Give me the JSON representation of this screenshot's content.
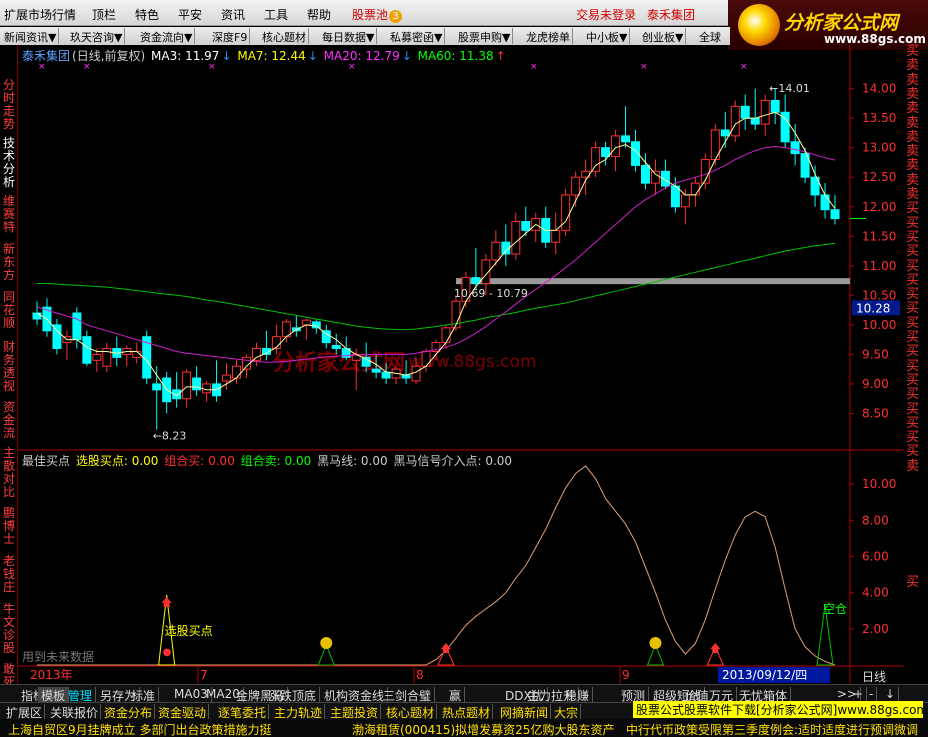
{
  "menubar": {
    "items": [
      "扩展市场行情",
      "顶栏",
      "特色",
      "平安",
      "资讯",
      "工具",
      "帮助"
    ],
    "stock_pool": "股票池",
    "stock_pool_badge": "3",
    "login": "交易未登录",
    "group": "泰禾集团"
  },
  "logo": {
    "title": "分析家公式网",
    "url": "www.88gs.com"
  },
  "toolbar": [
    "新闻资讯▼",
    "玖天咨询▼",
    "资金流向▼",
    "深度F9",
    "核心题材",
    "每日数据▼",
    "私募密函▼",
    "股票申购▼",
    "龙虎榜单",
    "中小板▼",
    "创业板▼",
    "全球"
  ],
  "sidebar": [
    "分时走势",
    "技术分析",
    "维赛特",
    "新东方",
    "同花顺",
    "财务透视",
    "资金流",
    "主散对比",
    "鹏博士",
    "老钱庄",
    "牛文诊股",
    "敢死队"
  ],
  "sell_column": [
    "买",
    "卖",
    "卖",
    "卖",
    "卖",
    "卖",
    "卖",
    "卖",
    "卖",
    "卖",
    "卖",
    "买",
    "买",
    "买",
    "买",
    "买",
    "买",
    "买",
    "买",
    "买",
    "买",
    "买",
    "买",
    "买",
    "买",
    "买",
    "买",
    "买",
    "买",
    "卖"
  ],
  "stock_header": {
    "name": "泰禾集团",
    "mode": "(日线,前复权)",
    "ma3": "MA3: 11.97",
    "ma7": "MA7: 12.44",
    "ma20": "MA20: 12.79",
    "ma60": "MA60: 11.38",
    "arrow_down": "↓"
  },
  "price_axis": [
    "14.00",
    "13.50",
    "13.00",
    "12.50",
    "12.00",
    "11.50",
    "11.00",
    "10.50",
    "10.00",
    "9.50",
    "9.00",
    "8.50"
  ],
  "current_price_tag": "10.28",
  "annotations": {
    "high": "14.01",
    "low": "8.23",
    "range": "10.69 - 10.79",
    "watermark_cn": "分析家公式网",
    "watermark_url": "www.88gs.com"
  },
  "indicator_header": {
    "best": "最佳买点",
    "pick": "选股买点: 0.00",
    "combo_buy": "组合买: 0.00",
    "combo_sell": "组合卖: 0.00",
    "dark_horse": "黑马线: 0.00",
    "dark_signal": "黑马信号介入点: 0.00"
  },
  "indicator_axis": [
    "10.00",
    "8.00",
    "6.00",
    "4.00",
    "2.00"
  ],
  "indicator_labels": {
    "pick_buy": "选股买点",
    "empty": "空仓",
    "future_data": "用到未来数据",
    "money": "$"
  },
  "date_axis": {
    "year": "2013年",
    "m7": "7",
    "m8": "8",
    "m9": "9",
    "cursor_date": "2013/09/12/四",
    "period": "日线"
  },
  "tabs1": [
    "指标",
    "模板",
    "管理",
    "另存为",
    "标准",
    "MA03",
    "MA20",
    "金牌黑马",
    "涨跌顶底",
    "机构资金线",
    "三剑合璧",
    "赢",
    "DDX优",
    "主力拉升",
    "稳赚",
    "预测",
    "超级短线",
    "价值万元",
    "无忧箱体"
  ],
  "tabs1_nav": [
    ">>",
    "+",
    "-",
    "↓"
  ],
  "tabs2": [
    "扩展区",
    "关联报价",
    "资金分布",
    "资金驱动",
    "逐笔委托",
    "主力轨迹",
    "主题投资",
    "核心题材",
    "热点题材",
    "网摘新闻",
    "大宗"
  ],
  "download_banner": "股票公式股票软件下载[分析家公式网]www.88gs.com",
  "ticker": [
    "上海自贸区9月挂牌成立 多部门出台政策措施力挺",
    "渤海租赁(000415)拟增发募资25亿购大股东资产",
    "中行代币政策受限第三季度例会:适时适度进行预调微调"
  ],
  "chart_data": {
    "type": "candlestick",
    "candles": [
      [
        10.2,
        10.4,
        10.0,
        10.1
      ],
      [
        10.3,
        10.45,
        9.8,
        9.9
      ],
      [
        10.0,
        10.1,
        9.5,
        9.6
      ],
      [
        9.7,
        9.9,
        9.4,
        9.8
      ],
      [
        10.2,
        10.3,
        9.6,
        9.75
      ],
      [
        9.8,
        9.9,
        9.3,
        9.35
      ],
      [
        9.4,
        9.6,
        9.2,
        9.5
      ],
      [
        9.3,
        9.7,
        9.2,
        9.6
      ],
      [
        9.6,
        9.8,
        9.3,
        9.45
      ],
      [
        9.5,
        9.65,
        9.3,
        9.6
      ],
      [
        9.45,
        9.7,
        9.35,
        9.55
      ],
      [
        9.8,
        9.9,
        9.0,
        9.1
      ],
      [
        9.0,
        9.3,
        8.23,
        8.9
      ],
      [
        9.1,
        9.2,
        8.5,
        8.7
      ],
      [
        8.9,
        9.2,
        8.6,
        8.75
      ],
      [
        8.75,
        9.25,
        8.6,
        9.2
      ],
      [
        9.1,
        9.3,
        8.8,
        8.9
      ],
      [
        8.85,
        9.05,
        8.7,
        9.0
      ],
      [
        9.0,
        9.4,
        8.7,
        8.8
      ],
      [
        9.05,
        9.35,
        8.9,
        9.15
      ],
      [
        9.1,
        9.4,
        9.0,
        9.3
      ],
      [
        9.25,
        9.5,
        9.1,
        9.45
      ],
      [
        9.4,
        9.7,
        9.3,
        9.6
      ],
      [
        9.6,
        9.9,
        9.4,
        9.5
      ],
      [
        9.6,
        10.0,
        9.5,
        9.8
      ],
      [
        9.8,
        10.1,
        9.7,
        10.05
      ],
      [
        9.95,
        10.15,
        9.8,
        9.9
      ],
      [
        10.0,
        10.1,
        9.75,
        10.08
      ],
      [
        10.05,
        10.1,
        9.85,
        9.95
      ],
      [
        9.9,
        10.0,
        9.6,
        9.7
      ],
      [
        9.65,
        9.85,
        9.5,
        9.6
      ],
      [
        9.6,
        9.8,
        9.4,
        9.45
      ],
      [
        9.4,
        9.6,
        8.9,
        9.5
      ],
      [
        9.45,
        9.7,
        9.2,
        9.3
      ],
      [
        9.25,
        9.5,
        9.1,
        9.2
      ],
      [
        9.2,
        9.35,
        9.0,
        9.1
      ],
      [
        9.1,
        9.3,
        9.0,
        9.25
      ],
      [
        9.15,
        9.4,
        9.0,
        9.1
      ],
      [
        9.05,
        9.45,
        9.0,
        9.3
      ],
      [
        9.3,
        9.6,
        9.2,
        9.55
      ],
      [
        9.55,
        9.75,
        9.4,
        9.7
      ],
      [
        9.7,
        10.0,
        9.6,
        9.95
      ],
      [
        9.95,
        10.5,
        9.9,
        10.4
      ],
      [
        10.4,
        10.9,
        10.3,
        10.8
      ],
      [
        10.8,
        11.3,
        10.6,
        10.7
      ],
      [
        10.7,
        11.2,
        10.5,
        11.1
      ],
      [
        11.1,
        11.6,
        11.0,
        11.4
      ],
      [
        11.4,
        11.7,
        11.0,
        11.2
      ],
      [
        11.2,
        11.9,
        11.1,
        11.75
      ],
      [
        11.75,
        12.0,
        11.5,
        11.6
      ],
      [
        11.6,
        11.9,
        11.4,
        11.8
      ],
      [
        11.8,
        12.0,
        11.3,
        11.4
      ],
      [
        11.4,
        11.9,
        11.2,
        11.6
      ],
      [
        11.6,
        12.3,
        11.5,
        12.2
      ],
      [
        12.2,
        12.6,
        12.0,
        12.5
      ],
      [
        12.5,
        12.8,
        12.2,
        12.6
      ],
      [
        12.6,
        13.1,
        12.5,
        13.0
      ],
      [
        13.0,
        13.1,
        12.7,
        12.85
      ],
      [
        12.85,
        13.3,
        12.6,
        13.2
      ],
      [
        13.2,
        13.7,
        13.0,
        13.1
      ],
      [
        13.1,
        13.3,
        12.6,
        12.7
      ],
      [
        12.7,
        12.9,
        12.3,
        12.4
      ],
      [
        12.4,
        12.8,
        12.2,
        12.6
      ],
      [
        12.6,
        12.8,
        12.3,
        12.35
      ],
      [
        12.35,
        12.5,
        11.9,
        12.0
      ],
      [
        12.0,
        12.3,
        11.7,
        12.2
      ],
      [
        12.2,
        12.5,
        12.0,
        12.4
      ],
      [
        12.4,
        12.9,
        12.3,
        12.8
      ],
      [
        12.8,
        13.4,
        12.7,
        13.3
      ],
      [
        13.3,
        13.6,
        13.0,
        13.2
      ],
      [
        13.2,
        13.8,
        13.1,
        13.7
      ],
      [
        13.7,
        13.9,
        13.3,
        13.5
      ],
      [
        13.5,
        14.0,
        13.3,
        13.4
      ],
      [
        13.4,
        13.9,
        13.2,
        13.8
      ],
      [
        13.8,
        14.01,
        13.4,
        13.6
      ],
      [
        13.6,
        13.9,
        13.0,
        13.1
      ],
      [
        13.1,
        13.4,
        12.7,
        12.9
      ],
      [
        12.9,
        13.0,
        12.4,
        12.5
      ],
      [
        12.5,
        12.7,
        12.0,
        12.2
      ],
      [
        12.2,
        12.4,
        11.8,
        11.95
      ],
      [
        11.95,
        12.2,
        11.7,
        11.8
      ]
    ],
    "ma3": [
      10.2,
      10.1,
      9.9,
      9.75,
      9.75,
      9.62,
      9.55,
      9.55,
      9.52,
      9.55,
      9.55,
      9.4,
      9.15,
      8.9,
      8.8,
      8.95,
      8.95,
      8.9,
      8.9,
      9.0,
      9.1,
      9.3,
      9.45,
      9.52,
      9.62,
      9.8,
      9.92,
      10.0,
      9.98,
      9.85,
      9.75,
      9.6,
      9.5,
      9.42,
      9.33,
      9.2,
      9.18,
      9.15,
      9.2,
      9.3,
      9.5,
      9.7,
      10.0,
      10.4,
      10.65,
      10.85,
      11.05,
      11.25,
      11.4,
      11.55,
      11.7,
      11.6,
      11.6,
      11.75,
      12.1,
      12.45,
      12.7,
      12.8,
      13.0,
      13.05,
      12.95,
      12.75,
      12.55,
      12.45,
      12.35,
      12.2,
      12.2,
      12.45,
      12.8,
      13.1,
      13.4,
      13.5,
      13.5,
      13.55,
      13.6,
      13.5,
      13.25,
      12.95,
      12.55,
      12.2,
      11.97
    ],
    "ma20": [
      10.3,
      10.25,
      10.2,
      10.15,
      10.1,
      10.0,
      9.95,
      9.9,
      9.85,
      9.8,
      9.75,
      9.7,
      9.65,
      9.6,
      9.55,
      9.52,
      9.5,
      9.48,
      9.46,
      9.44,
      9.42,
      9.4,
      9.38,
      9.37,
      9.37,
      9.38,
      9.4,
      9.42,
      9.44,
      9.46,
      9.47,
      9.48,
      9.49,
      9.5,
      9.5,
      9.5,
      9.5,
      9.5,
      9.52,
      9.55,
      9.58,
      9.62,
      9.68,
      9.76,
      9.86,
      9.97,
      10.1,
      10.22,
      10.35,
      10.48,
      10.6,
      10.72,
      10.84,
      10.97,
      11.1,
      11.25,
      11.4,
      11.55,
      11.7,
      11.85,
      12.0,
      12.12,
      12.22,
      12.32,
      12.4,
      12.45,
      12.5,
      12.55,
      12.62,
      12.7,
      12.8,
      12.88,
      12.95,
      13.0,
      13.02,
      13.0,
      12.97,
      12.93,
      12.88,
      12.83,
      12.79
    ],
    "ma60": [
      10.7,
      10.7,
      10.69,
      10.68,
      10.67,
      10.66,
      10.65,
      10.64,
      10.62,
      10.6,
      10.58,
      10.56,
      10.54,
      10.52,
      10.5,
      10.48,
      10.45,
      10.42,
      10.4,
      10.37,
      10.34,
      10.31,
      10.28,
      10.25,
      10.22,
      10.19,
      10.16,
      10.13,
      10.1,
      10.07,
      10.04,
      10.01,
      9.98,
      9.96,
      9.94,
      9.93,
      9.92,
      9.92,
      9.93,
      9.95,
      9.97,
      10.0,
      10.02,
      10.05,
      10.08,
      10.12,
      10.15,
      10.18,
      10.21,
      10.25,
      10.28,
      10.31,
      10.34,
      10.37,
      10.41,
      10.45,
      10.49,
      10.53,
      10.57,
      10.61,
      10.65,
      10.69,
      10.73,
      10.77,
      10.81,
      10.85,
      10.89,
      10.93,
      10.97,
      11.01,
      11.05,
      11.09,
      11.13,
      11.17,
      11.21,
      11.25,
      11.28,
      11.31,
      11.34,
      11.36,
      11.38
    ],
    "indicator": [
      0,
      0,
      0,
      0,
      0,
      0,
      0,
      0,
      0,
      0,
      0,
      0,
      0,
      0,
      0,
      0,
      0,
      0,
      0,
      0,
      0,
      0,
      0,
      0,
      0,
      0,
      0,
      0,
      0,
      0,
      0,
      0,
      0,
      0,
      0,
      0,
      0,
      0,
      0,
      0,
      0.3,
      0.8,
      1.5,
      2.2,
      2.7,
      3.1,
      3.5,
      4.0,
      4.8,
      5.5,
      6.5,
      7.5,
      8.7,
      9.8,
      10.6,
      11.0,
      10.3,
      9.2,
      8.5,
      7.8,
      6.8,
      5.4,
      4.0,
      2.5,
      1.3,
      0.6,
      1.2,
      2.5,
      4.2,
      5.8,
      7.2,
      8.2,
      8.5,
      8.2,
      6.5,
      4.2,
      2.0,
      1.0,
      0.5,
      0.2,
      0
    ],
    "ylim": [
      8.0,
      14.4
    ],
    "indicator_ylim": [
      0,
      11.5
    ]
  }
}
